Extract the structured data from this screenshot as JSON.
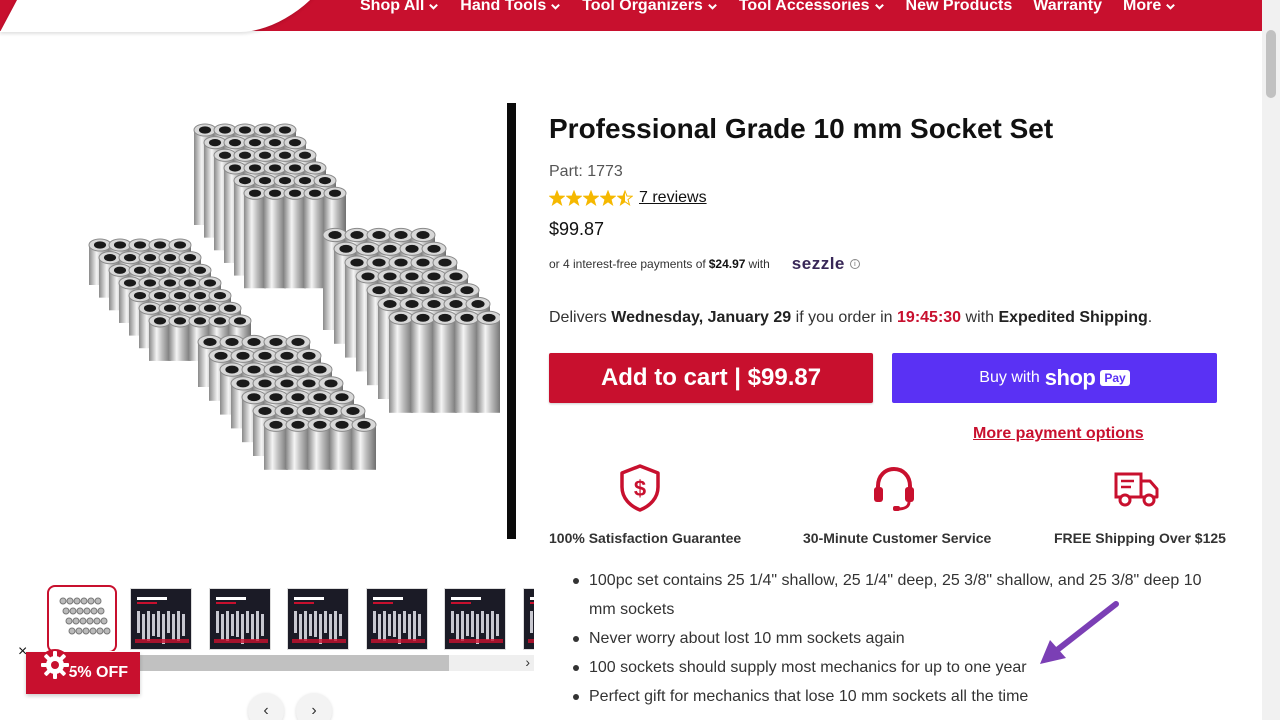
{
  "nav": {
    "items": [
      {
        "label": "Shop All",
        "has_menu": true
      },
      {
        "label": "Hand Tools",
        "has_menu": true
      },
      {
        "label": "Tool Organizers",
        "has_menu": true
      },
      {
        "label": "Tool Accessories",
        "has_menu": true
      },
      {
        "label": "New Products",
        "has_menu": false
      },
      {
        "label": "Warranty",
        "has_menu": false
      },
      {
        "label": "More",
        "has_menu": true
      }
    ]
  },
  "product": {
    "title": "Professional Grade 10 mm Socket Set",
    "part": "Part: 1773",
    "rating": 4.5,
    "reviews_label": "7 reviews",
    "price": "$99.87",
    "installments_prefix": "or 4 interest-free payments of",
    "installments_amount": "$24.97",
    "installments_suffix": "with",
    "sezzle_logo": "sezzle",
    "delivery_prefix": "Delivers",
    "delivery_date": "Wednesday, January 29",
    "delivery_mid": "if you order in",
    "delivery_countdown": "19:45:30",
    "delivery_with": "with",
    "delivery_method": "Expedited Shipping",
    "delivery_end": "."
  },
  "actions": {
    "add_to_cart": "Add to cart | $99.87",
    "buy_with": "Buy with",
    "shop_word": "shop",
    "pay_pill": "Pay",
    "more_payment": "More payment options"
  },
  "features": [
    {
      "icon": "shield-dollar-icon",
      "label": "100% Satisfaction Guarantee"
    },
    {
      "icon": "headset-icon",
      "label": "30-Minute Customer Service"
    },
    {
      "icon": "delivery-truck-icon",
      "label": "FREE Shipping Over $125"
    }
  ],
  "bullets": [
    "100pc set contains 25 1/4\" shallow, 25 1/4\" deep, 25 3/8\" shallow, and 25 3/8\" deep 10 mm sockets",
    "Never worry about lost 10 mm sockets again",
    "100 sockets should supply most mechanics for up to one year",
    "Perfect gift for mechanics that lose 10 mm sockets all the time"
  ],
  "gallery": {
    "thumbnail_count": 7,
    "active_index": 0,
    "scroll_fraction": 0.64
  },
  "discount": {
    "label": "5% OFF",
    "close": "×"
  },
  "colors": {
    "brand_red": "#c8102e",
    "shop_pay_purple": "#5a31f4",
    "star_yellow": "#f5b800",
    "annotation_arrow": "#7b3fb5"
  }
}
